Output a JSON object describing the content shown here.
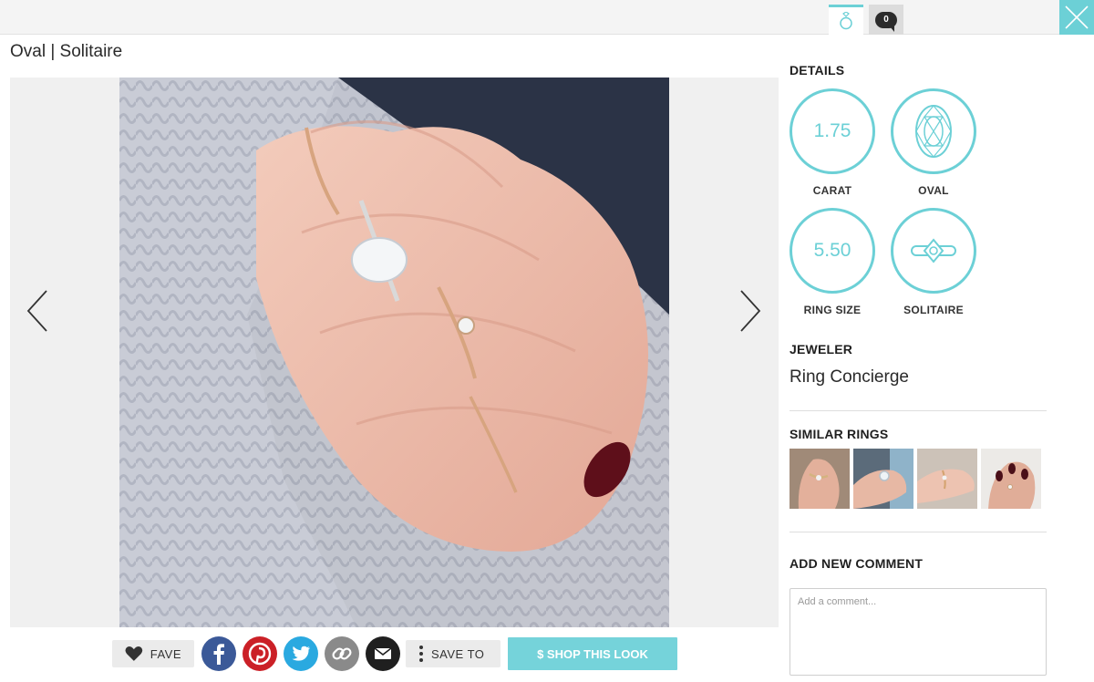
{
  "tabs": {
    "comment_count": "0"
  },
  "title": "Oval | Solitaire",
  "actions": {
    "fave_label": "FAVE",
    "save_label": "SAVE TO",
    "shop_label": "$ SHOP THIS LOOK"
  },
  "details": {
    "heading": "DETAILS",
    "items": [
      {
        "value": "1.75",
        "label": "CARAT"
      },
      {
        "icon": "oval-diamond-icon",
        "label": "OVAL"
      },
      {
        "value": "5.50",
        "label": "RING SIZE"
      },
      {
        "icon": "solitaire-setting-icon",
        "label": "SOLITAIRE"
      }
    ]
  },
  "jeweler": {
    "heading": "JEWELER",
    "name": "Ring Concierge"
  },
  "similar": {
    "heading": "SIMILAR RINGS"
  },
  "comment": {
    "heading": "ADD NEW COMMENT",
    "placeholder": "Add a comment..."
  },
  "colors": {
    "accent": "#6cd0d6",
    "shop_button": "#75d3da",
    "facebook": "#3b5998",
    "pinterest": "#cb2027",
    "twitter": "#2aa9e0",
    "link": "#8a8a8a",
    "email": "#1f1f1f"
  }
}
